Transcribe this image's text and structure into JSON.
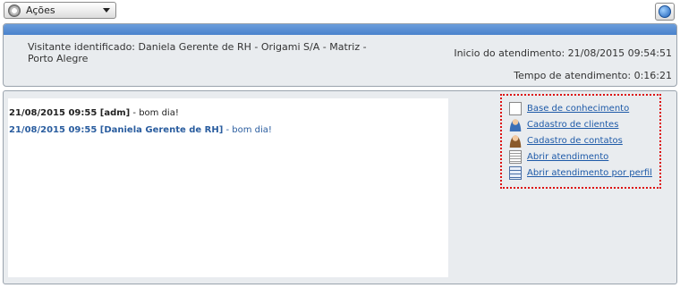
{
  "toolbar": {
    "actions_label": "Ações"
  },
  "header": {
    "visitor": "Visitante identificado: Daniela Gerente de RH - Origami S/A - Matriz - Porto Alegre",
    "start_label": "Inicio do atendimento: 21/08/2015 09:54:51",
    "duration_label": "Tempo de atendimento: 0:16:21"
  },
  "chat": {
    "messages": [
      {
        "meta": "21/08/2015 09:55 [adm]",
        "text": " - bom dia!"
      },
      {
        "meta": "21/08/2015 09:55 [Daniela Gerente de RH]",
        "text": " - bom dia!"
      }
    ]
  },
  "links": [
    {
      "label": "Base de conhecimento",
      "icon": "document-icon"
    },
    {
      "label": "Cadastro de clientes",
      "icon": "client-icon"
    },
    {
      "label": "Cadastro de contatos",
      "icon": "contact-icon"
    },
    {
      "label": "Abrir atendimento",
      "icon": "form-icon"
    },
    {
      "label": "Abrir atendimento por perfil",
      "icon": "list-icon"
    }
  ],
  "colors": {
    "header_bar": "#5a8fd4",
    "link": "#1e5aa8",
    "highlight_border": "#d11111"
  }
}
